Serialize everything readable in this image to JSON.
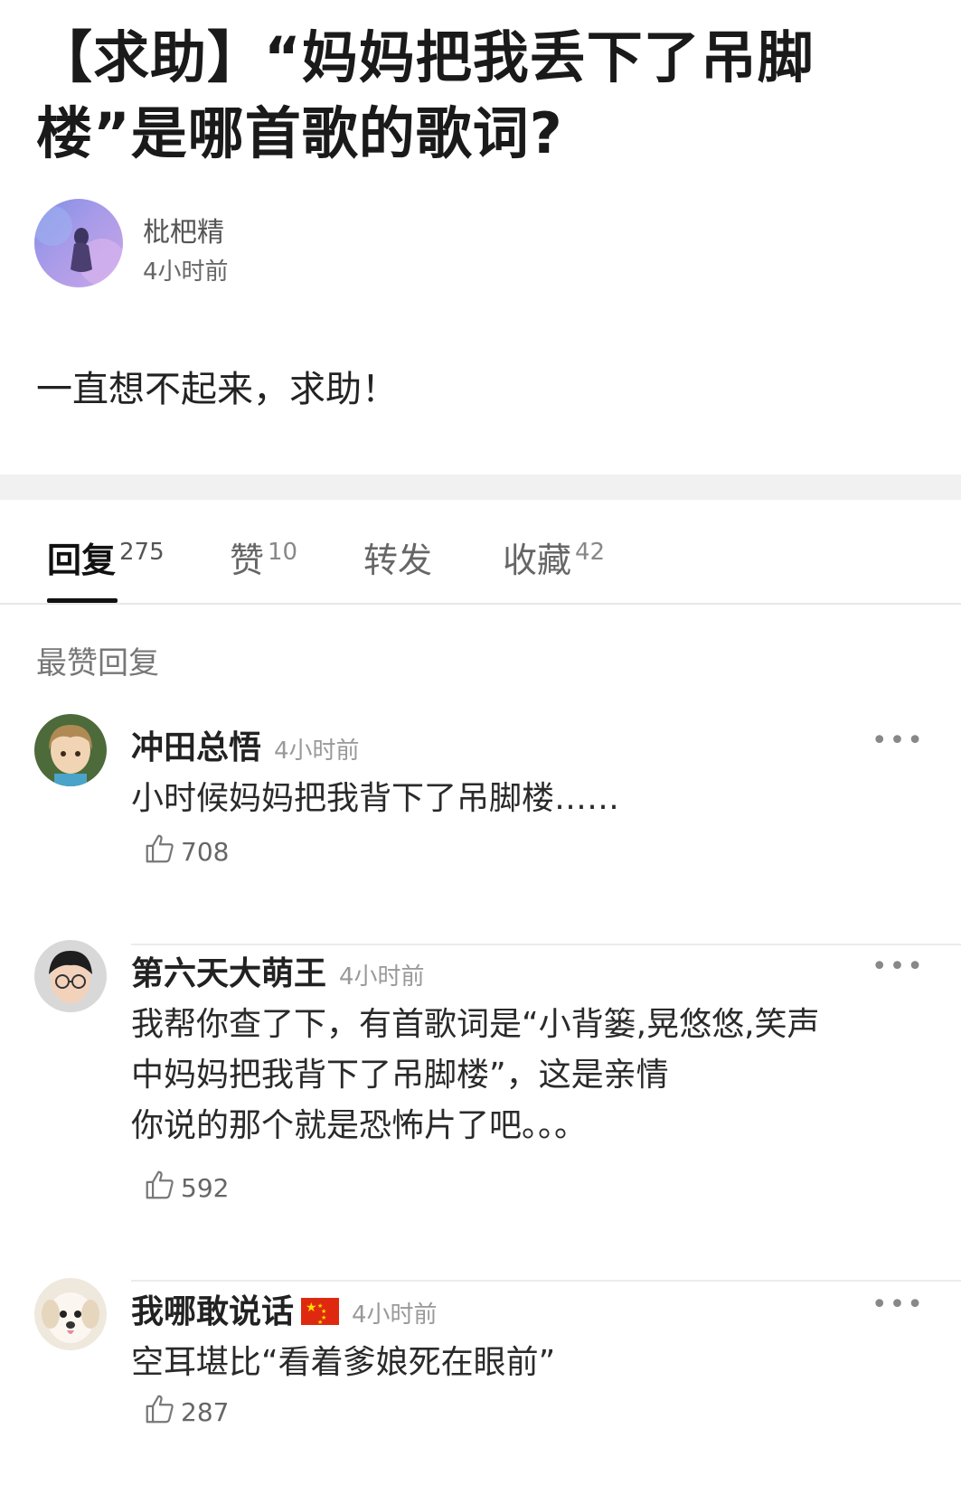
{
  "post": {
    "title": "【求助】“妈妈把我丢下了吊脚楼”是哪首歌的歌词?",
    "author": {
      "name": "枇杷精",
      "time": "4小时前"
    },
    "body": "一直想不起来，求助！"
  },
  "tabs": [
    {
      "label": "回复",
      "count": "275",
      "active": true
    },
    {
      "label": "赞",
      "count": "10",
      "active": false
    },
    {
      "label": "转发",
      "count": "",
      "active": false
    },
    {
      "label": "收藏",
      "count": "42",
      "active": false
    }
  ],
  "section_title": "最赞回复",
  "comments": [
    {
      "name": "冲田总悟",
      "time": "4小时前",
      "lines": [
        "小时候妈妈把我背下了吊脚楼……"
      ],
      "likes": "708",
      "more": "•••"
    },
    {
      "name": "第六天大萌王",
      "time": "4小时前",
      "lines": [
        "我帮你查了下，有首歌词是“小背篓,晃悠悠,笑声",
        "中妈妈把我背下了吊脚楼”，这是亲情",
        "你说的那个就是恐怖片了吧。。。"
      ],
      "likes": "592",
      "more": "•••"
    },
    {
      "name": "我哪敢说话",
      "time": "4小时前",
      "lines": [
        "空耳堪比“看着爹娘死在眼前”"
      ],
      "likes": "287",
      "more": "•••"
    }
  ],
  "icons": {
    "like": "thumbs-up-icon",
    "more": "more-dots-icon",
    "flag": "china-flag-icon"
  }
}
